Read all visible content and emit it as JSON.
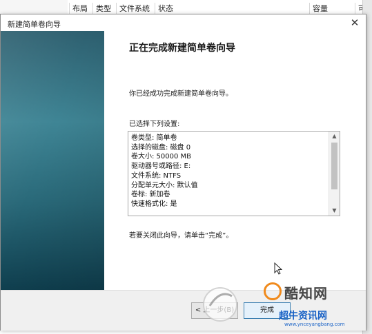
{
  "background": {
    "columns": [
      "布局",
      "类型",
      "文件系统",
      "状态",
      "容量",
      "可"
    ]
  },
  "wizard": {
    "title": "新建简单卷向导",
    "close_glyph": "✕",
    "heading": "正在完成新建简单卷向导",
    "message": "你已经成功完成新建简单卷向导。",
    "settings_label": "已选择下列设置:",
    "settings": [
      "卷类型: 简单卷",
      "选择的磁盘: 磁盘 0",
      "卷大小: 50000 MB",
      "驱动器号或路径: E:",
      "文件系统: NTFS",
      "分配单元大小: 默认值",
      "卷标: 新加卷",
      "快速格式化: 是"
    ],
    "close_hint": "若要关闭此向导，请单击“完成”。",
    "back_button": "< 上一步(B)",
    "finish_button": "完成"
  },
  "watermark": {
    "main": "酷知网",
    "sub": "超牛资讯网",
    "url": "www.ynceyangbang.com"
  },
  "colors": {
    "sidebar_top": "#2d5f6f",
    "sidebar_bottom": "#0f3f4f",
    "watermark_orange": "#f08a1c",
    "watermark_blue": "#1b63c6"
  }
}
